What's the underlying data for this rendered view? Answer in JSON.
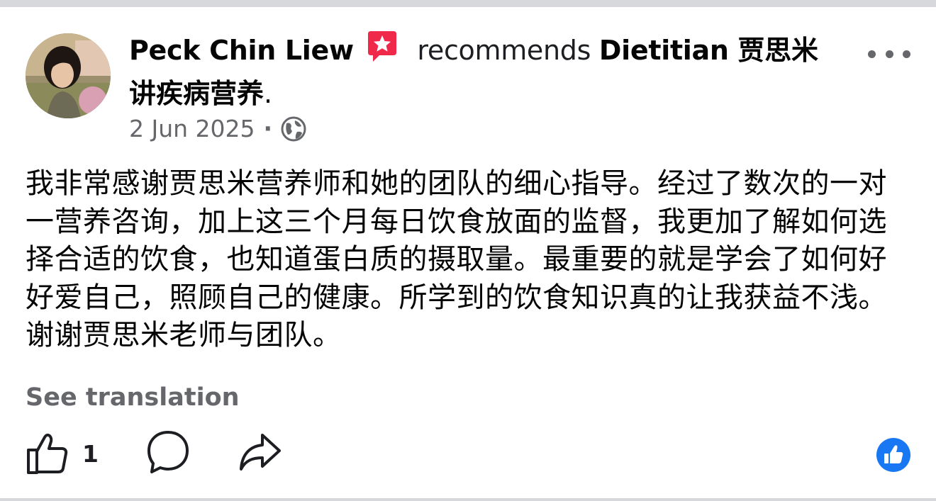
{
  "post": {
    "author": "Peck Chin Liew",
    "verb": "recommends",
    "page_name_line1": "Dietitian 贾思米",
    "page_name_line2": "讲疾病营养",
    "punct": ".",
    "date": "2 Jun 2025",
    "separator": "·",
    "body": "我非常感谢贾思米营养师和她的团队的细心指导。经过了数次的一对一营养咨询，加上这三个月每日饮食放面的监督，我更加了解如何选择合适的饮食，也知道蛋白质的摄取量。最重要的就是学会了如何好好爱自己，照顾自己的健康。所学到的饮食知识真的让我获益不浅。谢谢贾思米老师与团队。",
    "see_translation": "See translation"
  },
  "actions": {
    "like_count": "1"
  },
  "icons": {
    "avatar": "profile-photo",
    "recommend_badge": "recommend-star-icon",
    "more": "more-horizontal-icon",
    "audience": "globe-icon",
    "like": "thumbs-up-icon",
    "comment": "comment-bubble-icon",
    "share": "share-arrow-icon",
    "reaction": "like-reaction-icon"
  },
  "colors": {
    "text_primary": "#050505",
    "text_secondary": "#65676b",
    "recommend_red": "#f0284a",
    "like_blue": "#1877f2",
    "divider": "#d6d8dc"
  }
}
